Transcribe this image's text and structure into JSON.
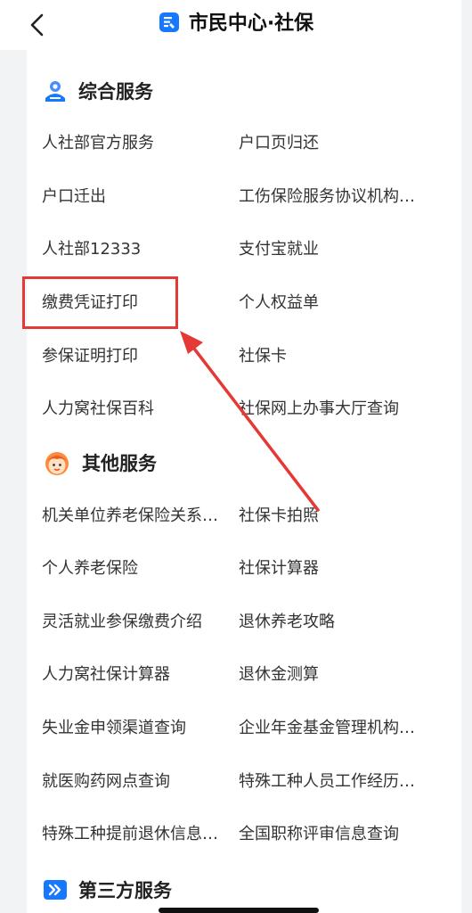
{
  "nav": {
    "title": "市民中心·社保"
  },
  "sections": [
    {
      "title": "综合服务",
      "icon": "person-service-icon",
      "items": [
        [
          "人社部官方服务",
          "户口页归还"
        ],
        [
          "户口迁出",
          "工伤保险服务协议机构…"
        ],
        [
          "人社部12333",
          "支付宝就业"
        ],
        [
          "缴费凭证打印",
          "个人权益单"
        ],
        [
          "参保证明打印",
          "社保卡"
        ],
        [
          "人力窝社保百科",
          "社保网上办事大厅查询"
        ]
      ]
    },
    {
      "title": "其他服务",
      "icon": "cartoon-face-icon",
      "items": [
        [
          "机关单位养老保险关系…",
          "社保卡拍照"
        ],
        [
          "个人养老保险",
          "社保计算器"
        ],
        [
          "灵活就业参保缴费介绍",
          "退休养老攻略"
        ],
        [
          "人力窝社保计算器",
          "退休金测算"
        ],
        [
          "失业金申领渠道查询",
          "企业年金基金管理机构…"
        ],
        [
          "就医购药网点查询",
          "特殊工种人员工作经历…"
        ],
        [
          "特殊工种提前退休信息…",
          "全国职称评审信息查询"
        ]
      ]
    },
    {
      "title": "第三方服务",
      "icon": "double-chevron-icon",
      "items": []
    }
  ],
  "colors": {
    "accent": "#1677ff",
    "highlight": "#e53935",
    "background": "#f2f3f5"
  }
}
